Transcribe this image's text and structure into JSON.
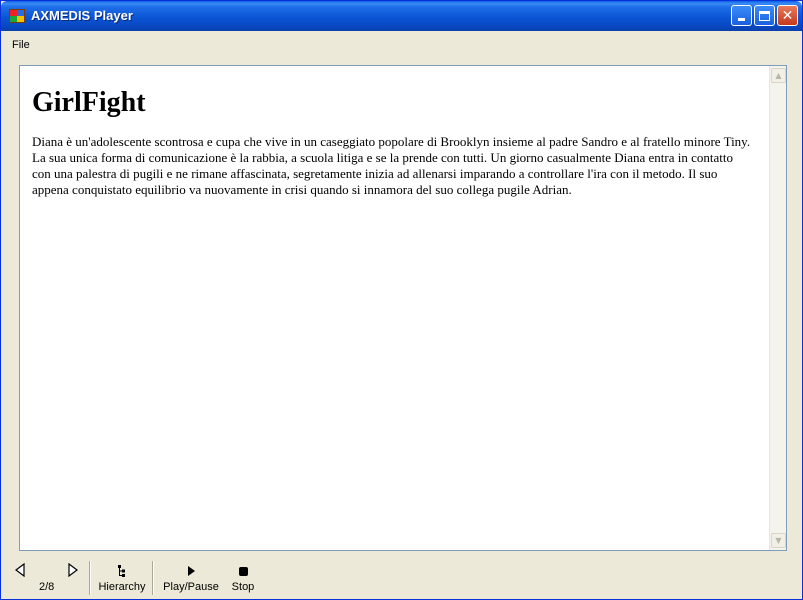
{
  "window": {
    "title": "AXMEDIS Player",
    "close_glyph": "✕"
  },
  "menu": {
    "items": [
      {
        "label": "File"
      }
    ]
  },
  "document": {
    "title": "GirlFight",
    "body": "Diana è un'adolescente scontrosa e cupa che vive in un caseggiato popolare di Brooklyn insieme al padre Sandro e al fratello minore Tiny. La sua unica forma di comunicazione è la rabbia, a scuola litiga e se la prende con tutti. Un giorno casualmente Diana entra in contatto con una palestra di pugili e ne rimane affascinata, segretamente inizia ad allenarsi imparando a controllare l'ira con il metodo. Il suo appena conquistato equilibrio va nuovamente in crisi quando si innamora del suo collega pugile Adrian."
  },
  "scrollbar": {
    "up_glyph": "▲",
    "down_glyph": "▼"
  },
  "toolbar": {
    "page_counter": "2/8",
    "hierarchy_label": "Hierarchy",
    "play_pause_label": "Play/Pause",
    "stop_label": "Stop"
  },
  "icons": {
    "app": "axmedis-app-icon",
    "prev": "triangle-left-icon",
    "next": "triangle-right-icon",
    "hierarchy": "hierarchy-icon",
    "play": "play-icon",
    "stop": "stop-icon"
  },
  "colors": {
    "titlebar": "#0b55d5",
    "window_bg": "#ece9d8",
    "close_button": "#c4391c",
    "content_border": "#7f9db9"
  }
}
